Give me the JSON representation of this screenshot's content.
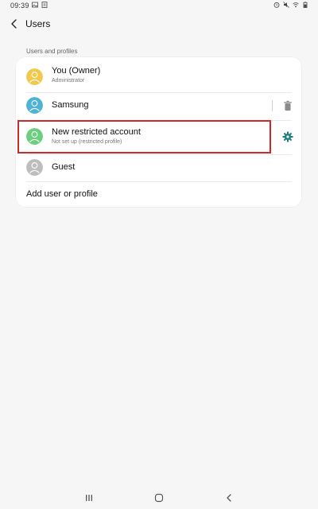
{
  "status_bar": {
    "time": "09:39",
    "left_icons": [
      "gallery-icon",
      "screenshot-icon"
    ],
    "right_icons": [
      "alarm-icon",
      "mute-icon",
      "wifi-icon",
      "battery-icon"
    ]
  },
  "app_bar": {
    "back_icon": "back-arrow-icon",
    "title": "Users"
  },
  "section": {
    "label": "Users and profiles"
  },
  "users": [
    {
      "name": "You (Owner)",
      "subtitle": "Administrator",
      "avatar_color": "#f2c94c",
      "avatar_icon": "person-icon"
    },
    {
      "name": "Samsung",
      "subtitle": "",
      "avatar_color": "#4fb3d6",
      "avatar_icon": "person-icon",
      "action_icon": "trash-icon"
    },
    {
      "name": "New restricted account",
      "subtitle": "Not set up (restricted profile)",
      "avatar_color": "#6bcf7f",
      "avatar_icon": "person-icon",
      "action_icon": "gear-icon"
    },
    {
      "name": "Guest",
      "subtitle": "",
      "avatar_color": "#bdbdbd",
      "avatar_icon": "person-icon"
    }
  ],
  "add_user": {
    "label": "Add user or profile"
  },
  "nav_bar": {
    "icons": [
      "recents-icon",
      "home-icon",
      "back-icon"
    ]
  },
  "colors": {
    "accent": "#1a7f7a",
    "highlight": "#cc2a2a",
    "background": "#f6f6f6",
    "card": "#ffffff"
  }
}
